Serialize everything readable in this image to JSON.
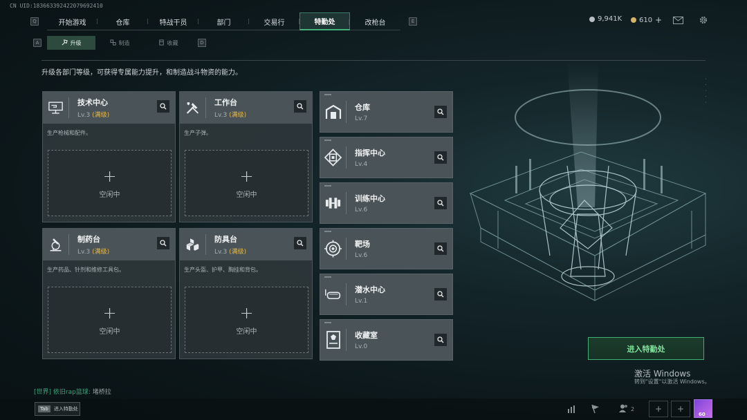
{
  "uid": "CN UID:183663392422079692410",
  "nav": {
    "left_key": "Q",
    "right_key": "E",
    "tabs": [
      {
        "label": "开始游戏"
      },
      {
        "label": "仓库"
      },
      {
        "label": "特战干员"
      },
      {
        "label": "部门"
      },
      {
        "label": "交易行"
      },
      {
        "label": "特勤处"
      },
      {
        "label": "改枪台"
      }
    ],
    "active_index": 5
  },
  "sub_nav": {
    "left_key": "A",
    "right_key": "D",
    "tabs": [
      {
        "label": "升级",
        "icon": "upgrade-icon"
      },
      {
        "label": "制造",
        "icon": "craft-icon"
      },
      {
        "label": "收藏",
        "icon": "collect-icon"
      }
    ],
    "active_index": 0
  },
  "currency": {
    "silver": "9,941K",
    "gold": "610",
    "gold_add": "+"
  },
  "description": "升级各部门等级，可获得专属能力提升，和制造战斗物资的能力。",
  "big_cards": [
    {
      "name": "技术中心",
      "level": "Lv.3",
      "max": "(满级)",
      "desc": "生产枪械和配件。",
      "slot": "空闲中",
      "icon": "tech-center-icon"
    },
    {
      "name": "工作台",
      "level": "Lv.3",
      "max": "(满级)",
      "desc": "生产子弹。",
      "slot": "空闲中",
      "icon": "workbench-icon"
    },
    {
      "name": "制药台",
      "level": "Lv.3",
      "max": "(满级)",
      "desc": "生产药品、针剂和维修工具包。",
      "slot": "空闲中",
      "icon": "pharmacy-icon"
    },
    {
      "name": "防具台",
      "level": "Lv.3",
      "max": "(满级)",
      "desc": "生产头盔、护甲、胸挂和背包。",
      "slot": "空闲中",
      "icon": "armor-bench-icon"
    }
  ],
  "small_cards": [
    {
      "name": "仓库",
      "level": "Lv.7",
      "icon": "warehouse-icon"
    },
    {
      "name": "指挥中心",
      "level": "Lv.4",
      "icon": "command-center-icon"
    },
    {
      "name": "训练中心",
      "level": "Lv.6",
      "icon": "training-center-icon"
    },
    {
      "name": "靶场",
      "level": "Lv.6",
      "icon": "range-icon"
    },
    {
      "name": "潜水中心",
      "level": "Lv.1",
      "icon": "diving-center-icon"
    },
    {
      "name": "收藏室",
      "level": "Lv.0",
      "icon": "collection-room-icon"
    }
  ],
  "enter_button": "进入特勤处",
  "windows_notice": {
    "title": "激活 Windows",
    "subtitle": "转到\"设置\"以激活 Windows。"
  },
  "chat": {
    "channel": "[世界]",
    "user": "依旧rap篮球:",
    "message": "堵桥拉"
  },
  "bottom": {
    "tab_key": "Tab",
    "tab_label": "进入特勤处",
    "friends_count": "2",
    "avatar_level": "60"
  },
  "colors": {
    "accent_green": "#46b07a",
    "max_level_gold": "#e6b94b"
  }
}
